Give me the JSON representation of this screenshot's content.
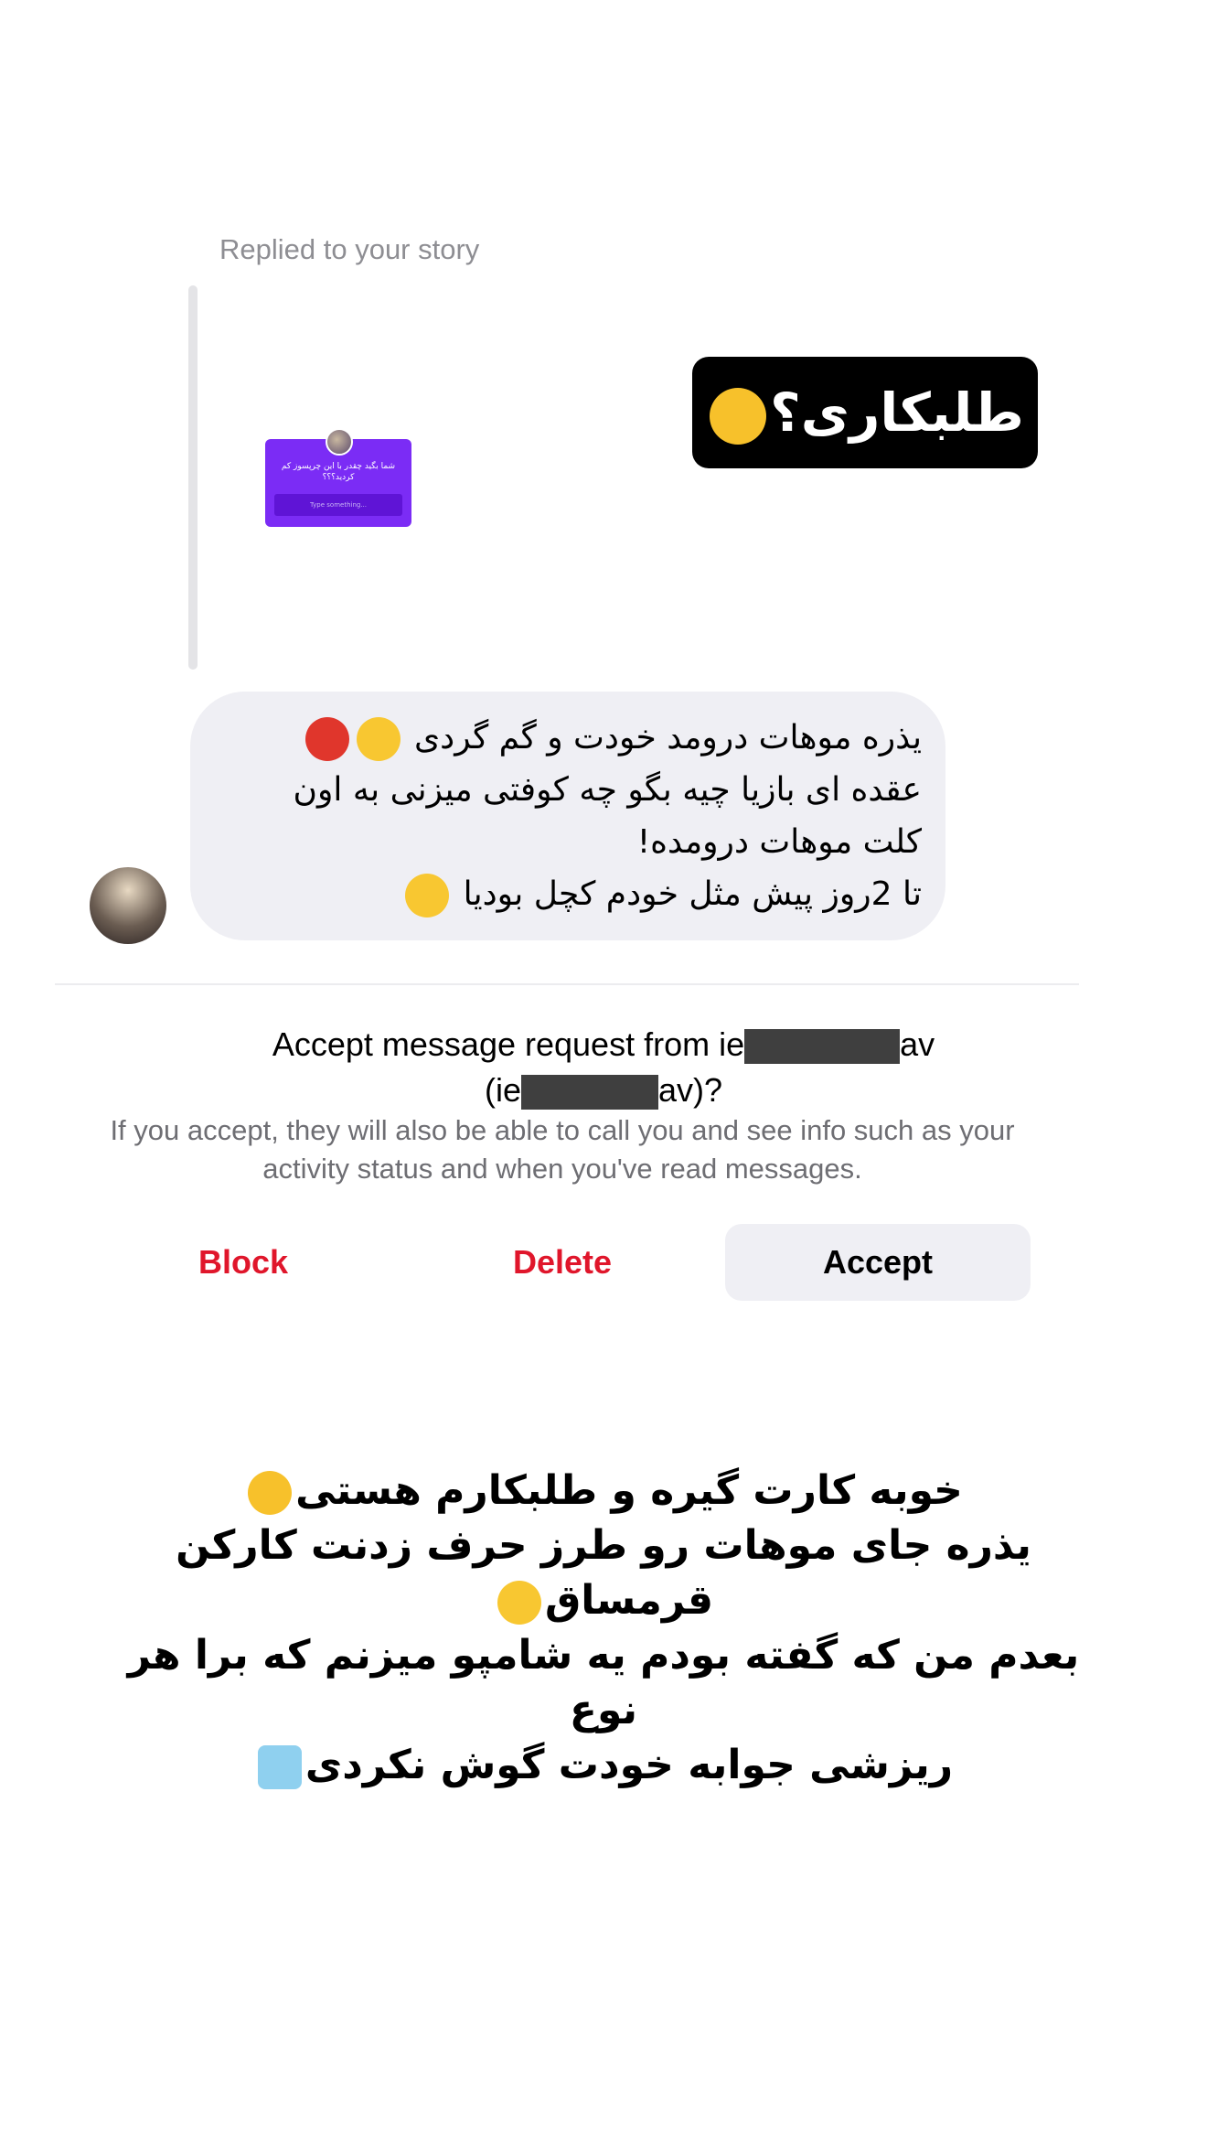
{
  "story": {
    "replied_label": "Replied to your story",
    "sticker_text": "طلبکاری؟",
    "thumbnail": {
      "question": "شما بگید چقدر با این چرپسوز کم کردید؟؟؟",
      "input_placeholder": "Type something..."
    }
  },
  "message": {
    "line1": "یذره موهات درومد خودت و گم گردی",
    "line2": "عقده ای بازیا چیه بگو چه کوفتی میزنی به اون",
    "line3": "کلت موهات درومده!",
    "line4": "تا 2روز پیش مثل خودم کچل بودیا"
  },
  "request": {
    "title_prefix": "Accept message request from ie",
    "title_suffix": "av",
    "handle_prefix": "(ie",
    "handle_suffix": "av)?",
    "note": "If you accept, they will also be able to call you and see info such as your activity status and when you've read messages.",
    "block_label": "Block",
    "delete_label": "Delete",
    "accept_label": "Accept"
  },
  "caption": {
    "line1": "خوبه کارت گیره و طلبکارم هستی",
    "line2": "یذره جای موهات رو طرز حرف زدنت کارکن قرمساق",
    "line3": "بعدم من که گفته بودم یه شامپو میزنم که برا هر نوع",
    "line4": "ریزشی جوابه خودت گوش نکردی"
  },
  "colors": {
    "danger": "#e0162b",
    "bubble": "#efeff4",
    "story_purple": "#7b2cf5"
  },
  "icons": [
    "flushed-face-icon",
    "smirk-face-icon",
    "angry-face-icon",
    "laughing-face-icon",
    "unamused-face-icon",
    "shrug-icon",
    "avatar"
  ]
}
